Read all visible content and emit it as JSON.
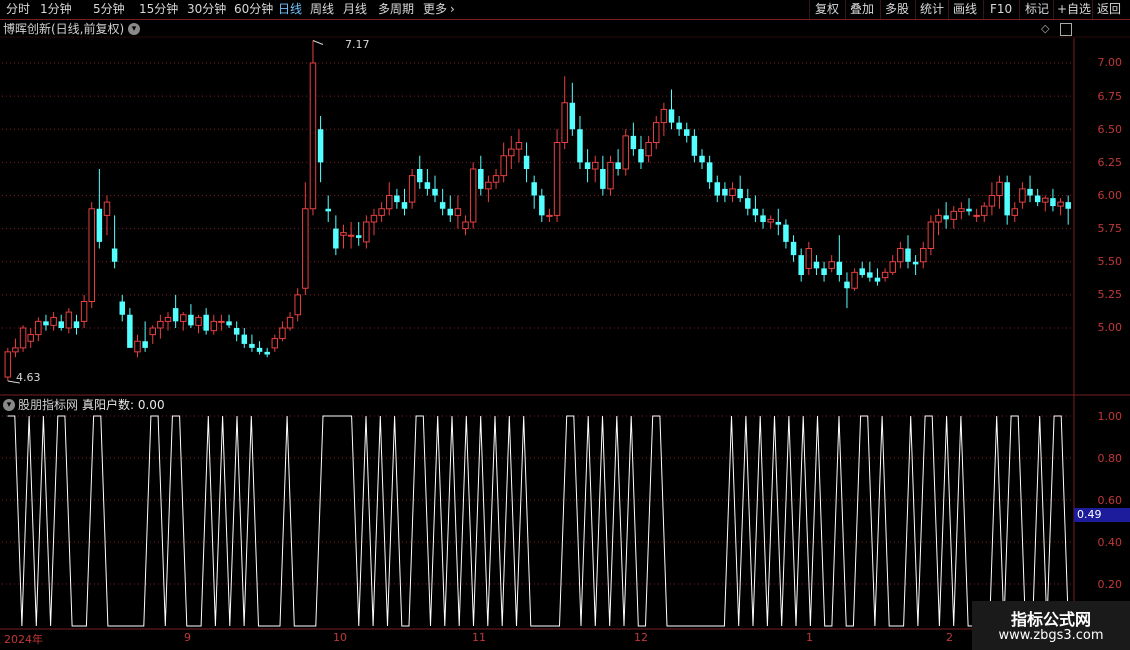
{
  "toolbar": {
    "periods": [
      "分时",
      "1分钟",
      "5分钟",
      "15分钟",
      "30分钟",
      "60分钟",
      "日线",
      "周线",
      "月线",
      "多周期",
      "更多"
    ],
    "active_period": "日线",
    "right_buttons": [
      "复权",
      "叠加",
      "多股",
      "统计",
      "画线",
      "F10",
      "标记",
      "+自选",
      "返回"
    ]
  },
  "main_chart": {
    "title": "博晖创新(日线,前复权)",
    "high_marker": "7.17",
    "low_marker": "4.63",
    "y_ticks": [
      "7.00",
      "6.75",
      "6.50",
      "6.25",
      "6.00",
      "5.75",
      "5.50",
      "5.25",
      "5.00"
    ]
  },
  "sub_chart": {
    "source": "股朋指标网",
    "indicator_label": "真阳户数: 0.00",
    "current_value": "0.49",
    "y_ticks": [
      "1.00",
      "0.80",
      "0.60",
      "0.40",
      "0.20"
    ]
  },
  "date_axis": [
    "2024年",
    "9",
    "10",
    "11",
    "12",
    "1",
    "2"
  ],
  "watermark": {
    "line1": "指标公式网",
    "line2": "www.zbgs3.com"
  },
  "colors": {
    "up": "#e84040",
    "down": "#54ffff",
    "line": "#ffffff",
    "grid": "#7a1f1f",
    "active": "#6ec3ff"
  },
  "chart_data": {
    "type": "candlestick",
    "title": "博晖创新(日线,前复权)",
    "ylim": [
      4.6,
      7.25
    ],
    "candles": [
      [
        4.63,
        4.85,
        4.6,
        4.82
      ],
      [
        4.82,
        4.92,
        4.78,
        4.85
      ],
      [
        4.85,
        5.02,
        4.82,
        5.0
      ],
      [
        4.9,
        5.0,
        4.85,
        4.95
      ],
      [
        4.95,
        5.08,
        4.9,
        5.05
      ],
      [
        5.05,
        5.1,
        4.98,
        5.02
      ],
      [
        5.02,
        5.12,
        4.98,
        5.08
      ],
      [
        5.05,
        5.1,
        4.98,
        5.0
      ],
      [
        5.0,
        5.15,
        4.96,
        5.12
      ],
      [
        5.05,
        5.1,
        4.95,
        5.0
      ],
      [
        5.05,
        5.25,
        5.0,
        5.2
      ],
      [
        5.2,
        5.95,
        5.15,
        5.9
      ],
      [
        5.9,
        6.2,
        5.6,
        5.65
      ],
      [
        5.85,
        6.0,
        5.7,
        5.95
      ],
      [
        5.6,
        5.85,
        5.45,
        5.5
      ],
      [
        5.2,
        5.25,
        5.05,
        5.1
      ],
      [
        5.1,
        5.15,
        4.85,
        4.85
      ],
      [
        4.82,
        4.95,
        4.78,
        4.9
      ],
      [
        4.9,
        5.05,
        4.82,
        4.85
      ],
      [
        4.95,
        5.02,
        4.88,
        5.0
      ],
      [
        5.0,
        5.1,
        4.92,
        5.05
      ],
      [
        5.05,
        5.12,
        4.98,
        5.08
      ],
      [
        5.15,
        5.25,
        5.0,
        5.05
      ],
      [
        5.05,
        5.12,
        4.98,
        5.1
      ],
      [
        5.1,
        5.18,
        5.0,
        5.02
      ],
      [
        5.02,
        5.1,
        4.96,
        5.08
      ],
      [
        5.1,
        5.15,
        4.95,
        4.98
      ],
      [
        4.98,
        5.1,
        4.95,
        5.05
      ],
      [
        5.05,
        5.1,
        4.98,
        5.05
      ],
      [
        5.05,
        5.1,
        5.0,
        5.02
      ],
      [
        5.0,
        5.05,
        4.9,
        4.95
      ],
      [
        4.95,
        5.0,
        4.85,
        4.88
      ],
      [
        4.88,
        4.95,
        4.82,
        4.85
      ],
      [
        4.85,
        4.9,
        4.8,
        4.82
      ],
      [
        4.82,
        4.85,
        4.78,
        4.8
      ],
      [
        4.85,
        4.95,
        4.82,
        4.92
      ],
      [
        4.92,
        5.05,
        4.9,
        5.0
      ],
      [
        5.0,
        5.12,
        4.98,
        5.08
      ],
      [
        5.1,
        5.3,
        5.05,
        5.25
      ],
      [
        5.3,
        6.1,
        5.25,
        5.9
      ],
      [
        5.9,
        7.17,
        5.85,
        7.0
      ],
      [
        6.5,
        6.6,
        6.1,
        6.25
      ],
      [
        5.9,
        6.0,
        5.8,
        5.88
      ],
      [
        5.75,
        5.85,
        5.55,
        5.6
      ],
      [
        5.7,
        5.78,
        5.6,
        5.72
      ],
      [
        5.7,
        5.8,
        5.6,
        5.7
      ],
      [
        5.7,
        5.8,
        5.62,
        5.68
      ],
      [
        5.65,
        5.85,
        5.6,
        5.8
      ],
      [
        5.8,
        5.9,
        5.7,
        5.85
      ],
      [
        5.85,
        5.95,
        5.8,
        5.9
      ],
      [
        5.9,
        6.1,
        5.85,
        6.0
      ],
      [
        6.0,
        6.05,
        5.9,
        5.95
      ],
      [
        5.95,
        6.05,
        5.85,
        5.9
      ],
      [
        5.95,
        6.2,
        5.9,
        6.15
      ],
      [
        6.2,
        6.3,
        6.05,
        6.1
      ],
      [
        6.1,
        6.2,
        6.0,
        6.05
      ],
      [
        6.05,
        6.15,
        5.95,
        6.0
      ],
      [
        5.95,
        6.05,
        5.85,
        5.9
      ],
      [
        5.9,
        6.0,
        5.8,
        5.85
      ],
      [
        5.85,
        6.0,
        5.75,
        5.9
      ],
      [
        5.75,
        5.85,
        5.7,
        5.8
      ],
      [
        5.8,
        6.25,
        5.75,
        6.2
      ],
      [
        6.2,
        6.3,
        6.0,
        6.05
      ],
      [
        6.05,
        6.15,
        5.95,
        6.1
      ],
      [
        6.1,
        6.2,
        6.05,
        6.15
      ],
      [
        6.15,
        6.4,
        6.1,
        6.3
      ],
      [
        6.3,
        6.45,
        6.2,
        6.35
      ],
      [
        6.35,
        6.5,
        6.25,
        6.4
      ],
      [
        6.3,
        6.4,
        6.1,
        6.2
      ],
      [
        6.1,
        6.15,
        5.9,
        6.0
      ],
      [
        6.0,
        6.05,
        5.8,
        5.85
      ],
      [
        5.85,
        5.9,
        5.8,
        5.85
      ],
      [
        5.85,
        6.5,
        5.8,
        6.4
      ],
      [
        6.4,
        6.9,
        6.35,
        6.7
      ],
      [
        6.7,
        6.85,
        6.45,
        6.5
      ],
      [
        6.5,
        6.6,
        6.2,
        6.25
      ],
      [
        6.25,
        6.35,
        6.1,
        6.2
      ],
      [
        6.2,
        6.3,
        6.1,
        6.25
      ],
      [
        6.2,
        6.3,
        6.0,
        6.05
      ],
      [
        6.05,
        6.3,
        6.0,
        6.25
      ],
      [
        6.25,
        6.35,
        6.15,
        6.2
      ],
      [
        6.2,
        6.5,
        6.15,
        6.45
      ],
      [
        6.45,
        6.55,
        6.3,
        6.35
      ],
      [
        6.35,
        6.45,
        6.2,
        6.25
      ],
      [
        6.3,
        6.45,
        6.25,
        6.4
      ],
      [
        6.4,
        6.6,
        6.35,
        6.55
      ],
      [
        6.55,
        6.7,
        6.45,
        6.65
      ],
      [
        6.65,
        6.8,
        6.5,
        6.55
      ],
      [
        6.55,
        6.6,
        6.45,
        6.5
      ],
      [
        6.5,
        6.55,
        6.4,
        6.45
      ],
      [
        6.45,
        6.5,
        6.25,
        6.3
      ],
      [
        6.3,
        6.35,
        6.2,
        6.25
      ],
      [
        6.25,
        6.3,
        6.05,
        6.1
      ],
      [
        6.1,
        6.15,
        5.95,
        6.0
      ],
      [
        6.05,
        6.1,
        5.95,
        6.0
      ],
      [
        6.0,
        6.1,
        5.95,
        6.05
      ],
      [
        6.05,
        6.15,
        5.95,
        5.98
      ],
      [
        5.98,
        6.05,
        5.85,
        5.9
      ],
      [
        5.9,
        6.0,
        5.8,
        5.85
      ],
      [
        5.85,
        5.9,
        5.75,
        5.8
      ],
      [
        5.8,
        5.85,
        5.75,
        5.82
      ],
      [
        5.8,
        5.9,
        5.7,
        5.78
      ],
      [
        5.78,
        5.82,
        5.6,
        5.65
      ],
      [
        5.65,
        5.7,
        5.5,
        5.55
      ],
      [
        5.55,
        5.6,
        5.35,
        5.4
      ],
      [
        5.45,
        5.65,
        5.4,
        5.6
      ],
      [
        5.5,
        5.55,
        5.4,
        5.45
      ],
      [
        5.45,
        5.5,
        5.35,
        5.4
      ],
      [
        5.45,
        5.55,
        5.42,
        5.5
      ],
      [
        5.5,
        5.7,
        5.35,
        5.4
      ],
      [
        5.35,
        5.42,
        5.15,
        5.3
      ],
      [
        5.3,
        5.45,
        5.28,
        5.42
      ],
      [
        5.45,
        5.5,
        5.38,
        5.4
      ],
      [
        5.42,
        5.5,
        5.35,
        5.38
      ],
      [
        5.38,
        5.45,
        5.32,
        5.35
      ],
      [
        5.38,
        5.45,
        5.35,
        5.42
      ],
      [
        5.42,
        5.55,
        5.4,
        5.5
      ],
      [
        5.5,
        5.65,
        5.45,
        5.6
      ],
      [
        5.6,
        5.7,
        5.45,
        5.5
      ],
      [
        5.5,
        5.55,
        5.4,
        5.48
      ],
      [
        5.5,
        5.65,
        5.45,
        5.6
      ],
      [
        5.6,
        5.85,
        5.55,
        5.8
      ],
      [
        5.8,
        5.9,
        5.7,
        5.85
      ],
      [
        5.85,
        5.95,
        5.75,
        5.82
      ],
      [
        5.82,
        5.92,
        5.75,
        5.88
      ],
      [
        5.88,
        5.95,
        5.82,
        5.9
      ],
      [
        5.9,
        5.98,
        5.85,
        5.88
      ],
      [
        5.85,
        5.9,
        5.8,
        5.85
      ],
      [
        5.85,
        5.95,
        5.8,
        5.92
      ],
      [
        5.92,
        6.1,
        5.85,
        6.0
      ],
      [
        6.0,
        6.15,
        5.9,
        6.1
      ],
      [
        6.1,
        6.15,
        5.78,
        5.85
      ],
      [
        5.85,
        5.95,
        5.8,
        5.9
      ],
      [
        5.95,
        6.1,
        5.9,
        6.05
      ],
      [
        6.05,
        6.15,
        5.95,
        6.0
      ],
      [
        6.0,
        6.05,
        5.92,
        5.95
      ],
      [
        5.95,
        6.0,
        5.88,
        5.98
      ],
      [
        5.98,
        6.05,
        5.88,
        5.92
      ],
      [
        5.92,
        5.98,
        5.85,
        5.95
      ],
      [
        5.95,
        6.0,
        5.78,
        5.9
      ]
    ],
    "sub_series": {
      "name": "真阳户数",
      "ylim": [
        0,
        1.05
      ],
      "values": [
        1,
        1,
        0,
        1,
        0,
        1,
        0,
        1,
        1,
        0,
        0,
        0,
        1,
        1,
        0,
        0,
        0,
        0,
        0,
        0,
        1,
        1,
        0,
        1,
        1,
        0,
        0,
        0,
        1,
        0,
        1,
        0,
        1,
        0,
        1,
        0,
        0,
        0,
        0,
        1,
        0,
        0,
        0,
        0,
        1,
        1,
        1,
        1,
        1,
        0,
        1,
        0,
        1,
        0,
        1,
        0,
        0,
        1,
        1,
        0,
        1,
        0,
        1,
        0,
        1,
        0,
        1,
        0,
        1,
        0,
        1,
        0,
        1,
        0,
        0,
        0,
        0,
        0,
        1,
        1,
        0,
        1,
        0,
        1,
        0,
        1,
        0,
        1,
        0,
        0,
        1,
        1,
        0,
        0,
        0,
        0,
        0,
        0,
        0,
        0,
        0,
        1,
        0,
        1,
        0,
        1,
        0,
        1,
        0,
        1,
        0,
        1,
        0,
        1,
        0,
        0,
        1,
        0,
        0,
        1,
        1,
        0,
        1,
        0,
        0,
        0,
        1,
        0,
        1,
        1,
        0,
        1,
        0,
        1,
        0,
        0,
        0,
        0,
        1,
        0,
        1,
        1,
        0,
        0,
        1,
        0,
        1,
        1,
        0
      ]
    }
  }
}
